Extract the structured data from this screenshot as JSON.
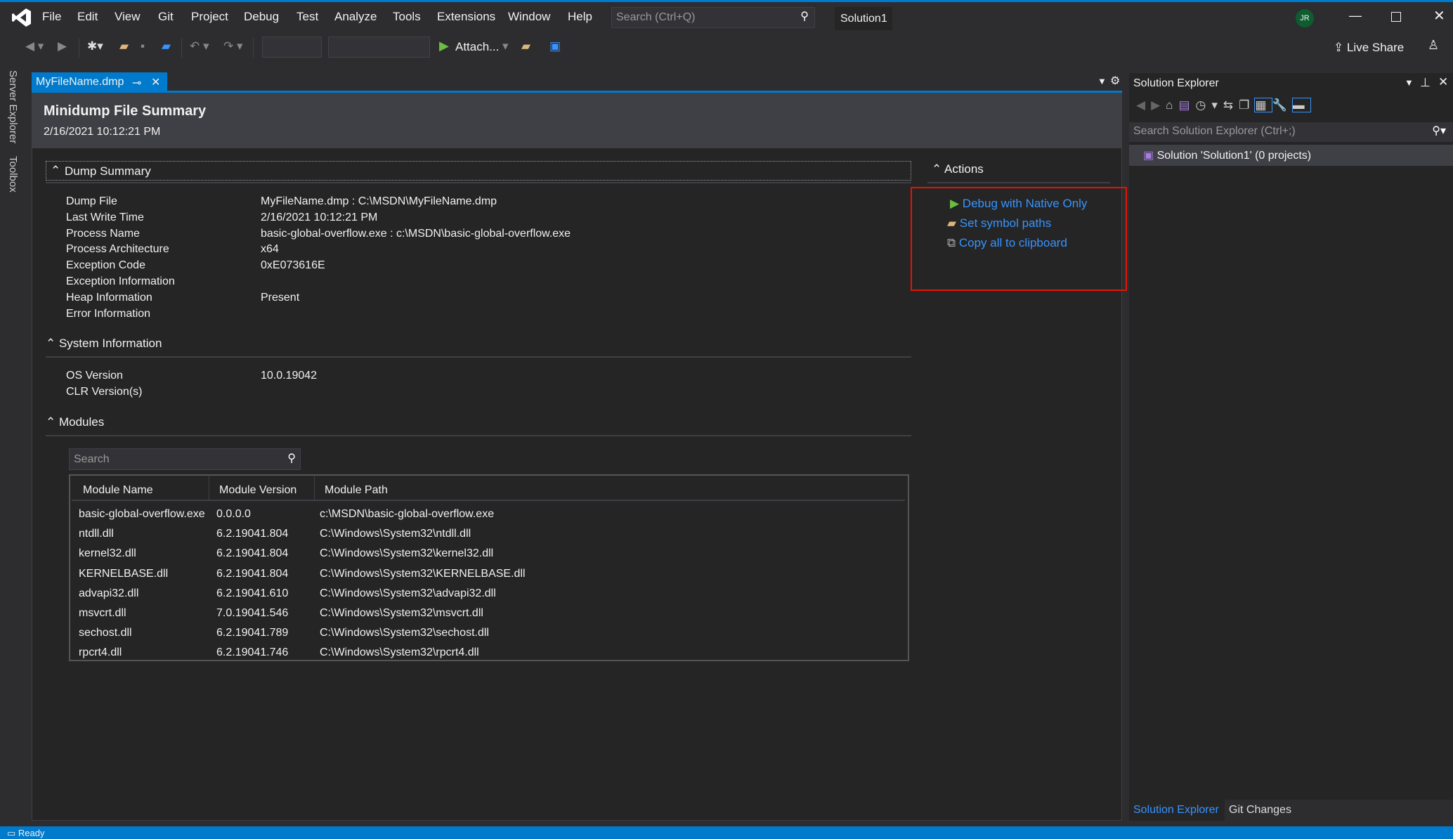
{
  "menu": [
    "File",
    "Edit",
    "View",
    "Git",
    "Project",
    "Debug",
    "Test",
    "Analyze",
    "Tools",
    "Extensions",
    "Window",
    "Help"
  ],
  "search_placeholder": "Search (Ctrl+Q)",
  "solution_name": "Solution1",
  "avatar": "JR",
  "toolbar": {
    "attach": "Attach...",
    "live_share": "Live Share"
  },
  "side_tabs": [
    "Server Explorer",
    "Toolbox"
  ],
  "tab": {
    "label": "MyFileName.dmp"
  },
  "doc": {
    "title": "Minidump File Summary",
    "date": "2/16/2021 10:12:21 PM",
    "dump_summary": {
      "title": "Dump Summary",
      "rows": [
        {
          "label": "Dump File",
          "value": "MyFileName.dmp : C:\\MSDN\\MyFileName.dmp"
        },
        {
          "label": "Last Write Time",
          "value": "2/16/2021 10:12:21 PM"
        },
        {
          "label": "Process Name",
          "value": "basic-global-overflow.exe : c:\\MSDN\\basic-global-overflow.exe"
        },
        {
          "label": "Process Architecture",
          "value": "x64"
        },
        {
          "label": "Exception Code",
          "value": "0xE073616E"
        },
        {
          "label": "Exception Information",
          "value": ""
        },
        {
          "label": "Heap Information",
          "value": "Present"
        },
        {
          "label": "Error Information",
          "value": ""
        }
      ]
    },
    "system_info": {
      "title": "System Information",
      "rows": [
        {
          "label": "OS Version",
          "value": "10.0.19042"
        },
        {
          "label": "CLR Version(s)",
          "value": ""
        }
      ]
    },
    "modules": {
      "title": "Modules",
      "search_placeholder": "Search",
      "columns": [
        "Module Name",
        "Module Version",
        "Module Path"
      ],
      "rows": [
        [
          "basic-global-overflow.exe",
          "0.0.0.0",
          "c:\\MSDN\\basic-global-overflow.exe"
        ],
        [
          "ntdll.dll",
          "6.2.19041.804",
          "C:\\Windows\\System32\\ntdll.dll"
        ],
        [
          "kernel32.dll",
          "6.2.19041.804",
          "C:\\Windows\\System32\\kernel32.dll"
        ],
        [
          "KERNELBASE.dll",
          "6.2.19041.804",
          "C:\\Windows\\System32\\KERNELBASE.dll"
        ],
        [
          "advapi32.dll",
          "6.2.19041.610",
          "C:\\Windows\\System32\\advapi32.dll"
        ],
        [
          "msvcrt.dll",
          "7.0.19041.546",
          "C:\\Windows\\System32\\msvcrt.dll"
        ],
        [
          "sechost.dll",
          "6.2.19041.789",
          "C:\\Windows\\System32\\sechost.dll"
        ],
        [
          "rpcrt4.dll",
          "6.2.19041.746",
          "C:\\Windows\\System32\\rpcrt4.dll"
        ]
      ]
    },
    "actions": {
      "title": "Actions",
      "items": [
        "Debug with Native Only",
        "Set symbol paths",
        "Copy all to clipboard"
      ]
    }
  },
  "solution_explorer": {
    "title": "Solution Explorer",
    "search_placeholder": "Search Solution Explorer (Ctrl+;)",
    "item": "Solution 'Solution1' (0 projects)",
    "tabs": [
      "Solution Explorer",
      "Git Changes"
    ]
  },
  "status": "Ready",
  "colors": {
    "accent": "#007acc",
    "link": "#3794ff",
    "highlight_box": "#e51400"
  }
}
